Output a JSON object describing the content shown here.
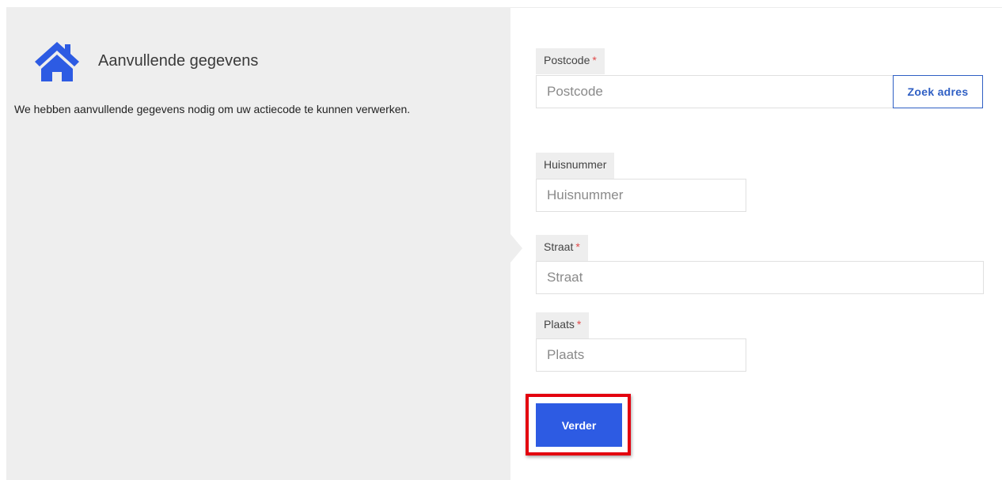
{
  "panel": {
    "icon": "home-icon",
    "title": "Aanvullende gegevens",
    "description": "We hebben aanvullende gegevens nodig om uw actiecode te kunnen verwerken."
  },
  "form": {
    "postcode": {
      "label": "Postcode",
      "required_marker": "*",
      "placeholder": "Postcode",
      "value": ""
    },
    "zoek_adres_label": "Zoek adres",
    "huisnummer": {
      "label": "Huisnummer",
      "placeholder": "Huisnummer",
      "value": ""
    },
    "straat": {
      "label": "Straat",
      "required_marker": "*",
      "placeholder": "Straat",
      "value": ""
    },
    "plaats": {
      "label": "Plaats",
      "required_marker": "*",
      "placeholder": "Plaats",
      "value": ""
    },
    "submit_label": "Verder"
  },
  "colors": {
    "accent_blue": "#2d5be3",
    "required_red": "#e04a4a",
    "highlight_red": "#e3000f",
    "panel_background": "#eeeeee"
  }
}
